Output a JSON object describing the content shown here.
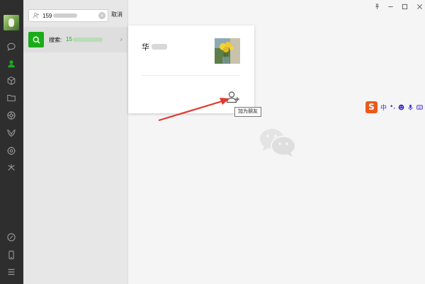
{
  "search": {
    "value": "159",
    "cancel_label": "取消"
  },
  "result": {
    "label": "搜索:",
    "value": "15"
  },
  "contact_card": {
    "name": "华",
    "add_friend_tooltip": "加为朋友"
  },
  "ime_toolbar": {
    "logo": "S",
    "mode": "中",
    "punct": "•,"
  },
  "colors": {
    "rail_bg": "#2e2e2e",
    "list_bg": "#e7e7e7",
    "accent_green": "#1aad19",
    "annotation_arrow": "#e03a2f",
    "ime_brand": "#ec5a1a"
  },
  "icons": {
    "rail": [
      "chat-icon",
      "contacts-icon",
      "favorites-icon",
      "files-icon",
      "moments-icon",
      "channels-icon",
      "mini-programs-icon",
      "discover-icon",
      "link-icon",
      "phone-icon",
      "menu-icon"
    ],
    "window": [
      "pin-icon",
      "minimize-icon",
      "maximize-icon",
      "close-icon"
    ]
  }
}
